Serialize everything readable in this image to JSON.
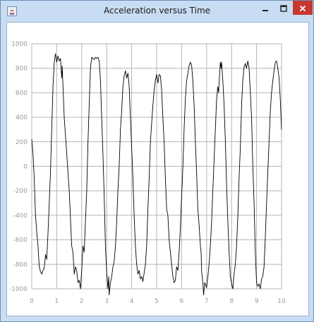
{
  "window": {
    "title": "Acceleration versus Time"
  },
  "icons": {
    "app": "java-app-icon",
    "minimize": "minimize-icon",
    "maximize": "maximize-icon",
    "close": "close-icon"
  },
  "colors": {
    "frame": "#c8dcf3",
    "close": "#c7372f",
    "grid": "#b4b4b4",
    "line": "#000000",
    "ticks": "#9a9a9a"
  },
  "chart_data": {
    "type": "line",
    "title": "",
    "xlabel": "",
    "ylabel": "",
    "xlim": [
      0,
      10
    ],
    "ylim": [
      -1000,
      1000
    ],
    "xticks": [
      "0",
      "1",
      "2",
      "3",
      "4",
      "5",
      "6",
      "7",
      "8",
      "9",
      "10"
    ],
    "yticks": [
      "1000",
      "800",
      "600",
      "400",
      "200",
      "0",
      "-200",
      "-400",
      "-600",
      "-800",
      "-1000"
    ],
    "grid": true,
    "legend": "none",
    "series": [
      {
        "values": [
          [
            0.0,
            220
          ],
          [
            0.05,
            100
          ],
          [
            0.1,
            -100
          ],
          [
            0.15,
            -400
          ],
          [
            0.2,
            -540
          ],
          [
            0.25,
            -650
          ],
          [
            0.3,
            -820
          ],
          [
            0.35,
            -860
          ],
          [
            0.4,
            -880
          ],
          [
            0.45,
            -850
          ],
          [
            0.5,
            -830
          ],
          [
            0.55,
            -720
          ],
          [
            0.6,
            -760
          ],
          [
            0.65,
            -550
          ],
          [
            0.7,
            -300
          ],
          [
            0.75,
            -50
          ],
          [
            0.8,
            300
          ],
          [
            0.85,
            650
          ],
          [
            0.9,
            850
          ],
          [
            0.95,
            920
          ],
          [
            1.0,
            850
          ],
          [
            1.05,
            900
          ],
          [
            1.1,
            860
          ],
          [
            1.15,
            880
          ],
          [
            1.2,
            720
          ],
          [
            1.22,
            820
          ],
          [
            1.25,
            650
          ],
          [
            1.3,
            400
          ],
          [
            1.4,
            100
          ],
          [
            1.5,
            -200
          ],
          [
            1.6,
            -650
          ],
          [
            1.65,
            -700
          ],
          [
            1.7,
            -880
          ],
          [
            1.75,
            -820
          ],
          [
            1.8,
            -850
          ],
          [
            1.85,
            -950
          ],
          [
            1.9,
            -930
          ],
          [
            1.95,
            -1000
          ],
          [
            2.0,
            -850
          ],
          [
            2.05,
            -650
          ],
          [
            2.1,
            -700
          ],
          [
            2.15,
            -450
          ],
          [
            2.2,
            -200
          ],
          [
            2.25,
            200
          ],
          [
            2.3,
            500
          ],
          [
            2.35,
            800
          ],
          [
            2.4,
            890
          ],
          [
            2.5,
            870
          ],
          [
            2.55,
            890
          ],
          [
            2.6,
            880
          ],
          [
            2.65,
            890
          ],
          [
            2.7,
            860
          ],
          [
            2.75,
            700
          ],
          [
            2.8,
            400
          ],
          [
            2.85,
            100
          ],
          [
            2.9,
            -250
          ],
          [
            2.95,
            -650
          ],
          [
            3.0,
            -870
          ],
          [
            3.05,
            -1000
          ],
          [
            3.08,
            -900
          ],
          [
            3.1,
            -1050
          ],
          [
            3.15,
            -950
          ],
          [
            3.2,
            -900
          ],
          [
            3.25,
            -820
          ],
          [
            3.3,
            -780
          ],
          [
            3.35,
            -650
          ],
          [
            3.4,
            -450
          ],
          [
            3.45,
            -200
          ],
          [
            3.5,
            0
          ],
          [
            3.55,
            300
          ],
          [
            3.6,
            450
          ],
          [
            3.65,
            650
          ],
          [
            3.7,
            740
          ],
          [
            3.75,
            780
          ],
          [
            3.8,
            720
          ],
          [
            3.85,
            760
          ],
          [
            3.9,
            650
          ],
          [
            3.95,
            400
          ],
          [
            4.0,
            150
          ],
          [
            4.05,
            -100
          ],
          [
            4.1,
            -400
          ],
          [
            4.15,
            -650
          ],
          [
            4.2,
            -800
          ],
          [
            4.25,
            -880
          ],
          [
            4.3,
            -850
          ],
          [
            4.35,
            -920
          ],
          [
            4.4,
            -900
          ],
          [
            4.45,
            -940
          ],
          [
            4.5,
            -870
          ],
          [
            4.55,
            -800
          ],
          [
            4.6,
            -650
          ],
          [
            4.65,
            -350
          ],
          [
            4.7,
            -100
          ],
          [
            4.75,
            200
          ],
          [
            4.8,
            350
          ],
          [
            4.85,
            500
          ],
          [
            4.9,
            620
          ],
          [
            4.95,
            700
          ],
          [
            5.0,
            750
          ],
          [
            5.05,
            680
          ],
          [
            5.1,
            750
          ],
          [
            5.15,
            740
          ],
          [
            5.2,
            620
          ],
          [
            5.25,
            400
          ],
          [
            5.3,
            200
          ],
          [
            5.35,
            -100
          ],
          [
            5.4,
            -350
          ],
          [
            5.45,
            -400
          ],
          [
            5.5,
            -600
          ],
          [
            5.55,
            -700
          ],
          [
            5.6,
            -800
          ],
          [
            5.65,
            -900
          ],
          [
            5.7,
            -950
          ],
          [
            5.75,
            -930
          ],
          [
            5.8,
            -820
          ],
          [
            5.85,
            -850
          ],
          [
            5.9,
            -700
          ],
          [
            5.95,
            -500
          ],
          [
            6.0,
            -250
          ],
          [
            6.05,
            0
          ],
          [
            6.1,
            300
          ],
          [
            6.15,
            550
          ],
          [
            6.2,
            700
          ],
          [
            6.25,
            760
          ],
          [
            6.3,
            820
          ],
          [
            6.35,
            850
          ],
          [
            6.4,
            820
          ],
          [
            6.45,
            700
          ],
          [
            6.5,
            500
          ],
          [
            6.55,
            200
          ],
          [
            6.6,
            -50
          ],
          [
            6.65,
            -350
          ],
          [
            6.7,
            -480
          ],
          [
            6.75,
            -650
          ],
          [
            6.78,
            -700
          ],
          [
            6.8,
            -850
          ],
          [
            6.85,
            -950
          ],
          [
            6.88,
            -1050
          ],
          [
            6.92,
            -950
          ],
          [
            6.95,
            -960
          ],
          [
            7.0,
            -990
          ],
          [
            7.05,
            -900
          ],
          [
            7.1,
            -800
          ],
          [
            7.15,
            -650
          ],
          [
            7.2,
            -450
          ],
          [
            7.25,
            -200
          ],
          [
            7.3,
            50
          ],
          [
            7.35,
            300
          ],
          [
            7.4,
            550
          ],
          [
            7.45,
            650
          ],
          [
            7.48,
            600
          ],
          [
            7.5,
            680
          ],
          [
            7.55,
            850
          ],
          [
            7.58,
            800
          ],
          [
            7.6,
            850
          ],
          [
            7.65,
            700
          ],
          [
            7.7,
            500
          ],
          [
            7.75,
            200
          ],
          [
            7.8,
            -150
          ],
          [
            7.85,
            -450
          ],
          [
            7.9,
            -700
          ],
          [
            7.95,
            -900
          ],
          [
            8.0,
            -960
          ],
          [
            8.05,
            -1000
          ],
          [
            8.1,
            -880
          ],
          [
            8.15,
            -800
          ],
          [
            8.2,
            -650
          ],
          [
            8.25,
            -400
          ],
          [
            8.3,
            -100
          ],
          [
            8.35,
            150
          ],
          [
            8.4,
            500
          ],
          [
            8.45,
            700
          ],
          [
            8.5,
            810
          ],
          [
            8.55,
            840
          ],
          [
            8.6,
            800
          ],
          [
            8.65,
            860
          ],
          [
            8.7,
            800
          ],
          [
            8.75,
            600
          ],
          [
            8.8,
            400
          ],
          [
            8.85,
            0
          ],
          [
            8.9,
            -300
          ],
          [
            8.95,
            -700
          ],
          [
            9.0,
            -950
          ],
          [
            9.05,
            -980
          ],
          [
            9.1,
            -960
          ],
          [
            9.15,
            -1000
          ],
          [
            9.2,
            -920
          ],
          [
            9.25,
            -900
          ],
          [
            9.3,
            -820
          ],
          [
            9.35,
            -580
          ],
          [
            9.4,
            -300
          ],
          [
            9.45,
            -50
          ],
          [
            9.5,
            200
          ],
          [
            9.55,
            450
          ],
          [
            9.6,
            600
          ],
          [
            9.65,
            700
          ],
          [
            9.7,
            780
          ],
          [
            9.75,
            850
          ],
          [
            9.8,
            860
          ],
          [
            9.85,
            800
          ],
          [
            9.9,
            720
          ],
          [
            9.95,
            550
          ],
          [
            10.0,
            300
          ]
        ]
      }
    ]
  }
}
